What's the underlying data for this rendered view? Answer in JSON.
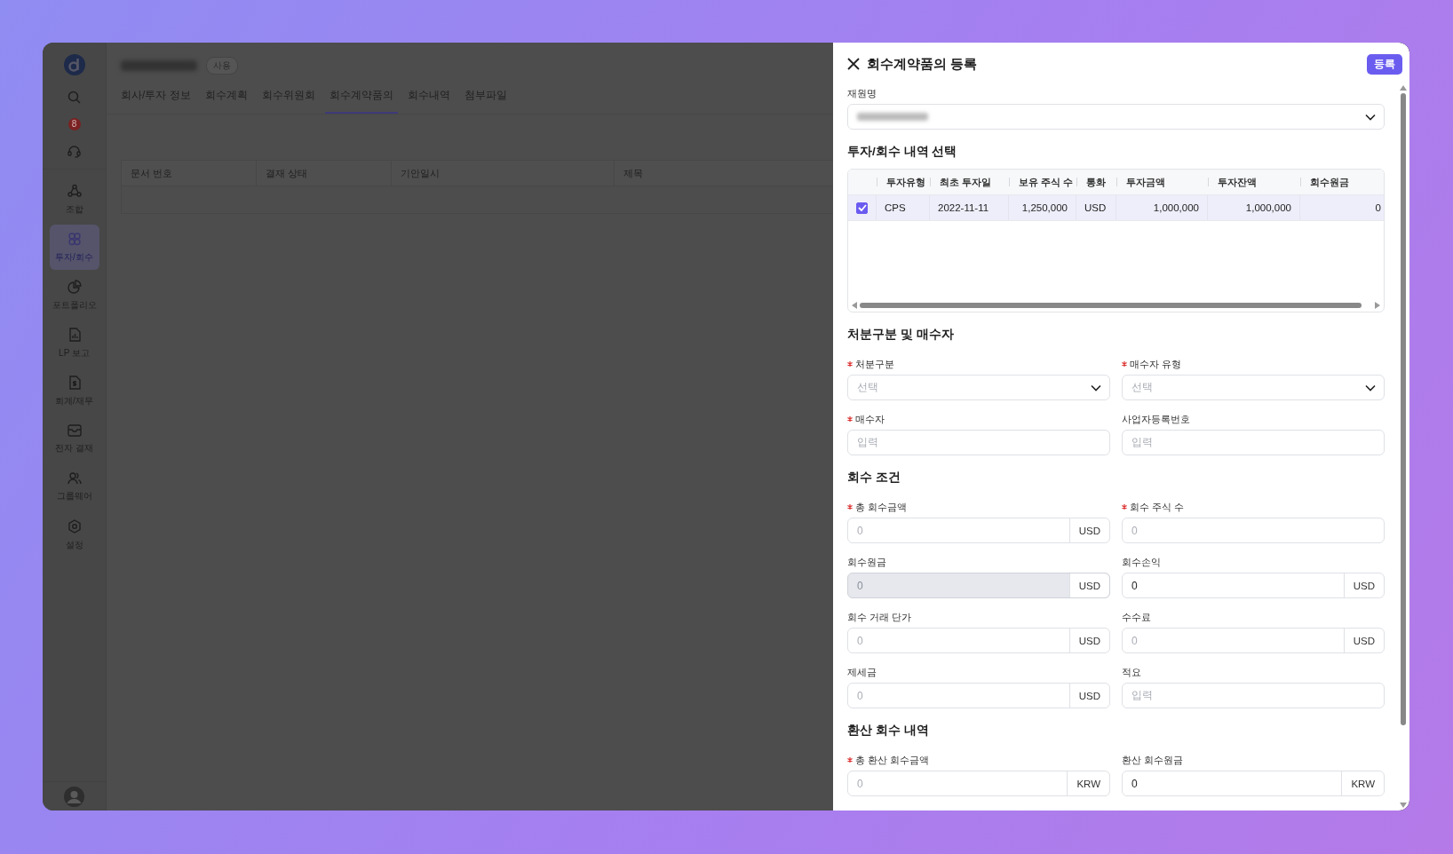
{
  "sidebar": {
    "notification_count": "8",
    "items": [
      {
        "label": "조합",
        "selected": false
      },
      {
        "label": "투자/회수",
        "selected": true
      },
      {
        "label": "포트폴리오",
        "selected": false
      },
      {
        "label": "LP 보고",
        "selected": false
      },
      {
        "label": "회계/재무",
        "selected": false
      },
      {
        "label": "전자 결재",
        "selected": false
      },
      {
        "label": "그룹웨어",
        "selected": false
      },
      {
        "label": "설정",
        "selected": false
      }
    ]
  },
  "header": {
    "status_badge": "사용",
    "tabs": [
      {
        "label": "회사/투자 정보",
        "selected": false
      },
      {
        "label": "회수계획",
        "selected": false
      },
      {
        "label": "회수위원회",
        "selected": false
      },
      {
        "label": "회수계약품의",
        "selected": true
      },
      {
        "label": "회수내역",
        "selected": false
      },
      {
        "label": "첨부파일",
        "selected": false
      }
    ]
  },
  "document_table": {
    "columns": [
      "문서 번호",
      "결재 상태",
      "기안일시",
      "제목"
    ]
  },
  "drawer": {
    "title": "회수계약품의 등록",
    "submit_button": "등록",
    "fund_field": {
      "label": "재원명"
    },
    "investment_section": {
      "title": "투자/회수 내역 선택",
      "columns": [
        "투자유형",
        "최초 투자일",
        "보유 주식 수",
        "통화",
        "투자금액",
        "투자잔액",
        "회수원금"
      ],
      "rows": [
        {
          "selected": true,
          "cells": [
            "CPS",
            "2022-11-11",
            "1,250,000",
            "USD",
            "1,000,000",
            "1,000,000",
            "0"
          ]
        }
      ]
    },
    "sections": [
      {
        "title": "처분구분 및 매수자",
        "fields": [
          {
            "kind": "select",
            "label": "처분구분",
            "required": true,
            "placeholder": "선택"
          },
          {
            "kind": "select",
            "label": "매수자 유형",
            "required": true,
            "placeholder": "선택"
          },
          {
            "kind": "text",
            "label": "매수자",
            "required": true,
            "placeholder": "입력"
          },
          {
            "kind": "text",
            "label": "사업자등록번호",
            "required": false,
            "placeholder": "입력"
          }
        ]
      },
      {
        "title": "회수 조건",
        "fields": [
          {
            "kind": "amount",
            "label": "총 회수금액",
            "required": true,
            "placeholder": "0",
            "unit": "USD",
            "disabled": false
          },
          {
            "kind": "text",
            "label": "회수 주식 수",
            "required": true,
            "placeholder": "0"
          },
          {
            "kind": "amount",
            "label": "회수원금",
            "required": false,
            "placeholder": "0",
            "unit": "USD",
            "disabled": true
          },
          {
            "kind": "amount",
            "label": "회수손익",
            "required": false,
            "value": "0",
            "unit": "USD",
            "disabled": false
          },
          {
            "kind": "amount",
            "label": "회수 거래 단가",
            "required": false,
            "placeholder": "0",
            "unit": "USD",
            "disabled": false
          },
          {
            "kind": "amount",
            "label": "수수료",
            "required": false,
            "placeholder": "0",
            "unit": "USD",
            "disabled": false
          },
          {
            "kind": "amount",
            "label": "제세금",
            "required": false,
            "placeholder": "0",
            "unit": "USD",
            "disabled": false
          },
          {
            "kind": "text",
            "label": "적요",
            "required": false,
            "placeholder": "입력"
          }
        ]
      },
      {
        "title": "환산 회수 내역",
        "fields": [
          {
            "kind": "amount",
            "label": "총 환산 회수금액",
            "required": true,
            "placeholder": "0",
            "unit": "KRW",
            "disabled": false
          },
          {
            "kind": "amount",
            "label": "환산 회수원금",
            "required": false,
            "value": "0",
            "unit": "KRW",
            "disabled": false
          }
        ]
      }
    ]
  }
}
